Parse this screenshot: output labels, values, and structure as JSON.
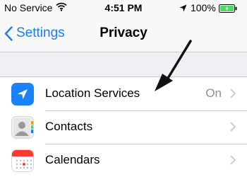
{
  "status_bar": {
    "carrier": "No Service",
    "time": "4:51 PM",
    "battery_percent": "100%"
  },
  "nav": {
    "back_label": "Settings",
    "title": "Privacy"
  },
  "rows": [
    {
      "label": "Location Services",
      "value": "On",
      "icon": "location-arrow-icon"
    },
    {
      "label": "Contacts",
      "value": "",
      "icon": "contacts-icon"
    },
    {
      "label": "Calendars",
      "value": "",
      "icon": "calendar-icon"
    }
  ],
  "colors": {
    "accent": "#157efb",
    "location_icon_bg": "#1a82fb",
    "background": "#efeff4",
    "separator": "#c8c7cc",
    "secondary_text": "#8e8e93"
  }
}
